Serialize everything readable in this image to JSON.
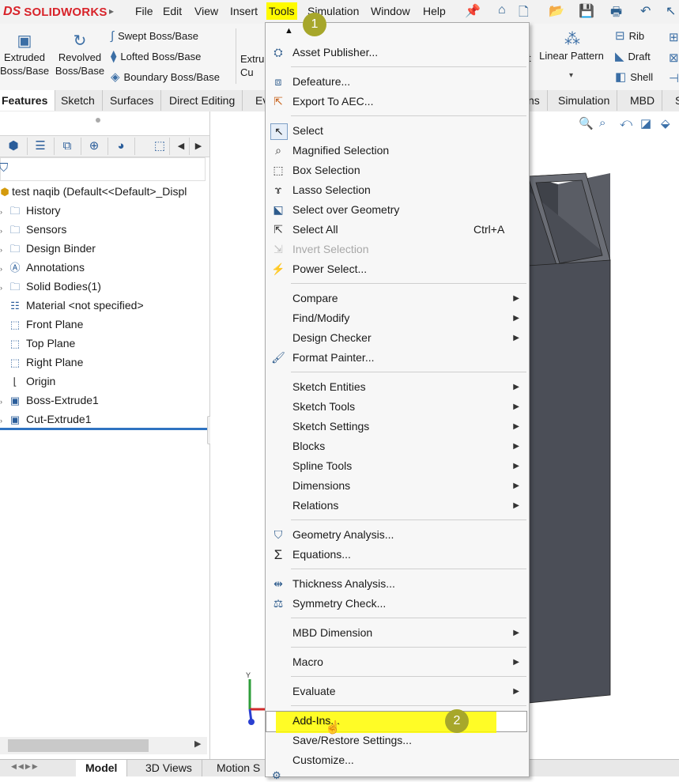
{
  "menubar": {
    "logo_ds": "DS",
    "logo_name": "SOLIDWORKS",
    "items": [
      "File",
      "Edit",
      "View",
      "Insert",
      "Tools",
      "Simulation",
      "Window",
      "Help"
    ],
    "active_index": 4
  },
  "commands": {
    "extruded": "Extruded Boss/Base",
    "revolved": "Revolved Boss/Base",
    "swept": "Swept Boss/Base",
    "lofted": "Lofted Boss/Base",
    "boundary": "Boundary Boss/Base",
    "extrude_cut_partial": "Extru Cu",
    "linear_pattern": "Linear Pattern",
    "rib": "Rib",
    "draft": "Draft",
    "shell": "Shell"
  },
  "tabs": [
    "Features",
    "Sketch",
    "Surfaces",
    "Direct Editing",
    "Ev",
    "ns",
    "Simulation",
    "MBD",
    "S"
  ],
  "tree": {
    "root": "test naqib  (Default<<Default>_Displ",
    "items": [
      {
        "label": "History",
        "icon": "folder-icon"
      },
      {
        "label": "Sensors",
        "icon": "folder-icon"
      },
      {
        "label": "Design Binder",
        "icon": "folder-icon"
      },
      {
        "label": "Annotations",
        "icon": "annotation-icon"
      },
      {
        "label": "Solid Bodies(1)",
        "icon": "folder-icon"
      },
      {
        "label": "Material <not specified>",
        "icon": "material-icon"
      },
      {
        "label": "Front Plane",
        "icon": "plane-icon"
      },
      {
        "label": "Top Plane",
        "icon": "plane-icon"
      },
      {
        "label": "Right Plane",
        "icon": "plane-icon"
      },
      {
        "label": "Origin",
        "icon": "origin-icon"
      },
      {
        "label": "Boss-Extrude1",
        "icon": "extrude-icon"
      },
      {
        "label": "Cut-Extrude1",
        "icon": "cut-icon"
      }
    ]
  },
  "bottom_tabs": [
    "Model",
    "3D Views",
    "Motion S"
  ],
  "tools_menu": {
    "asset_publisher": "Asset Publisher...",
    "defeature": "Defeature...",
    "export_aec": "Export To AEC...",
    "select": "Select",
    "magnified_selection": "Magnified Selection",
    "box_selection": "Box Selection",
    "lasso_selection": "Lasso Selection",
    "select_over_geometry": "Select over Geometry",
    "select_all": "Select All",
    "select_all_shortcut": "Ctrl+A",
    "invert_selection": "Invert Selection",
    "power_select": "Power Select...",
    "compare": "Compare",
    "find_modify": "Find/Modify",
    "design_checker": "Design Checker",
    "format_painter": "Format Painter...",
    "sketch_entities": "Sketch Entities",
    "sketch_tools": "Sketch Tools",
    "sketch_settings": "Sketch Settings",
    "blocks": "Blocks",
    "spline_tools": "Spline Tools",
    "dimensions": "Dimensions",
    "relations": "Relations",
    "geometry_analysis": "Geometry Analysis...",
    "equations": "Equations...",
    "thickness_analysis": "Thickness Analysis...",
    "symmetry_check": "Symmetry Check...",
    "mbd_dimension": "MBD Dimension",
    "macro": "Macro",
    "evaluate": "Evaluate",
    "add_ins": "Add-Ins...",
    "save_restore": "Save/Restore Settings...",
    "customize": "Customize..."
  },
  "annotations": {
    "step1": "1",
    "step2": "2"
  },
  "colors": {
    "highlight": "#fffb00",
    "badge": "#a7a72b",
    "brand": "#d8232a",
    "model": "#4a4d55"
  }
}
